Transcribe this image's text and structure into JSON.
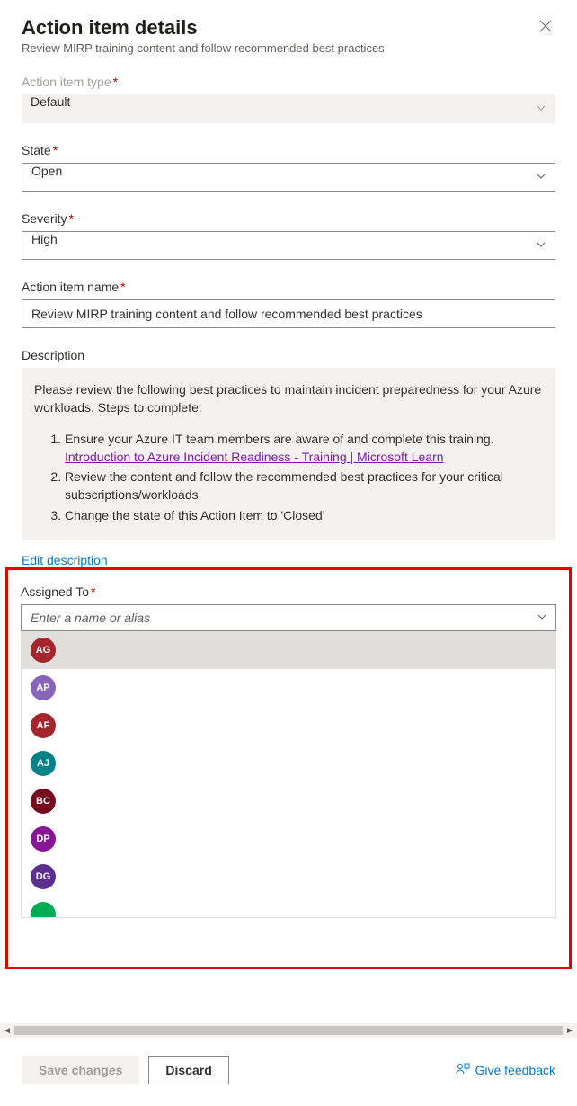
{
  "header": {
    "title": "Action item details",
    "subtitle": "Review MIRP training content and follow recommended best practices"
  },
  "fields": {
    "type": {
      "label": "Action item type",
      "value": "Default"
    },
    "state": {
      "label": "State",
      "value": "Open"
    },
    "severity": {
      "label": "Severity",
      "value": "High"
    },
    "name": {
      "label": "Action item name",
      "value": "Review MIRP training content and follow recommended best practices"
    },
    "description": {
      "label": "Description",
      "intro": "Please review the following best practices to maintain incident preparedness for your Azure workloads. Steps to complete:",
      "step1": "Ensure your Azure IT team members are aware of and complete this training.",
      "link_text": "Introduction to Azure Incident Readiness - Training | Microsoft Learn",
      "step2": "Review the content and follow the recommended best practices for your critical subscriptions/workloads.",
      "step3": "Change the state of this Action Item to 'Closed'",
      "edit_link": "Edit description"
    },
    "assigned": {
      "label": "Assigned To",
      "placeholder": "Enter a name or alias"
    }
  },
  "people": [
    {
      "initials": "AG",
      "color": "bg-maroon",
      "selected": true
    },
    {
      "initials": "AP",
      "color": "bg-purple",
      "selected": false
    },
    {
      "initials": "AF",
      "color": "bg-red",
      "selected": false
    },
    {
      "initials": "AJ",
      "color": "bg-teal",
      "selected": false
    },
    {
      "initials": "BC",
      "color": "bg-darkred",
      "selected": false
    },
    {
      "initials": "DP",
      "color": "bg-magenta",
      "selected": false
    },
    {
      "initials": "DG",
      "color": "bg-purple2",
      "selected": false
    },
    {
      "initials": "",
      "color": "bg-teal2",
      "selected": false
    }
  ],
  "footer": {
    "save": "Save changes",
    "discard": "Discard",
    "feedback": "Give feedback"
  }
}
